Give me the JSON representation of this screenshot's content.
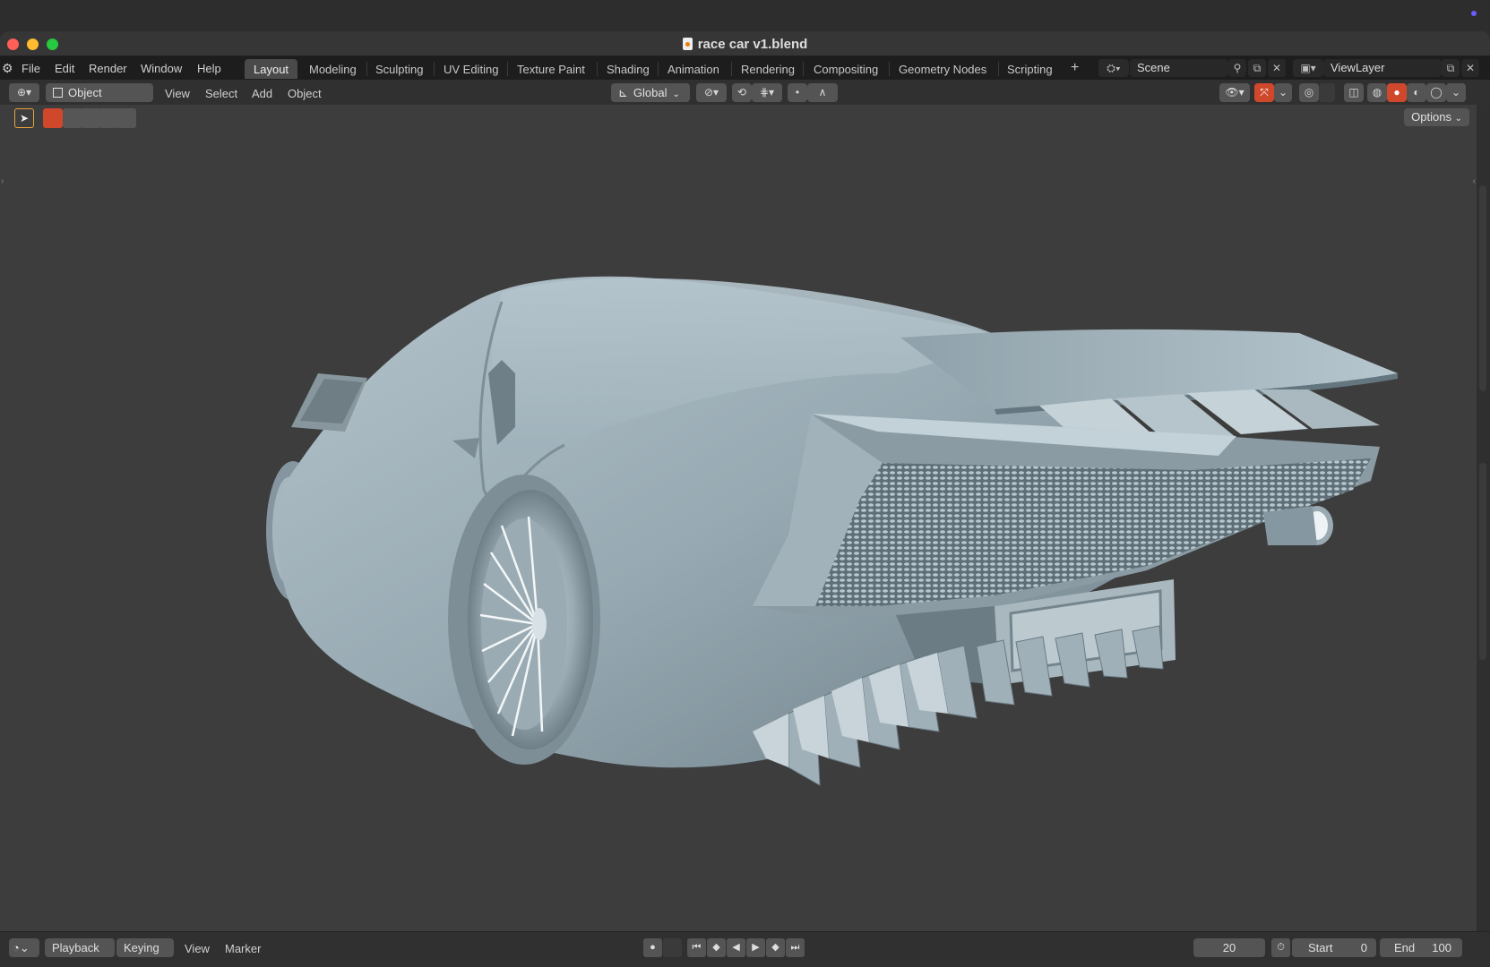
{
  "window": {
    "title": "race car v1.blend"
  },
  "menu": [
    "File",
    "Edit",
    "Render",
    "Window",
    "Help"
  ],
  "workspaces": [
    "Layout",
    "Modeling",
    "Sculpting",
    "UV Editing",
    "Texture Paint",
    "Shading",
    "Animation",
    "Rendering",
    "Compositing",
    "Geometry Nodes",
    "Scripting"
  ],
  "active_workspace": "Layout",
  "scene": {
    "name": "Scene",
    "view_layer": "ViewLayer"
  },
  "header": {
    "mode": "Object Mode",
    "menus": [
      "View",
      "Select",
      "Add",
      "Object"
    ],
    "transform_orientation": "Global",
    "options_label": "Options"
  },
  "timeline": {
    "playback": "Playback",
    "keying": "Keying",
    "view": "View",
    "marker": "Marker",
    "current_frame": "20",
    "start_label": "Start",
    "start": "0",
    "end_label": "End",
    "end": "100"
  },
  "icons": {
    "add_workspace": "+",
    "viewport_shading": [
      "wireframe-icon",
      "solid-icon",
      "material-icon",
      "rendered-icon"
    ],
    "colors": {
      "accent_orange": "#e87d0d",
      "active_red": "#d0482c",
      "close": "#ff5f57",
      "minimize": "#febc2e",
      "maximize": "#28c840"
    }
  }
}
